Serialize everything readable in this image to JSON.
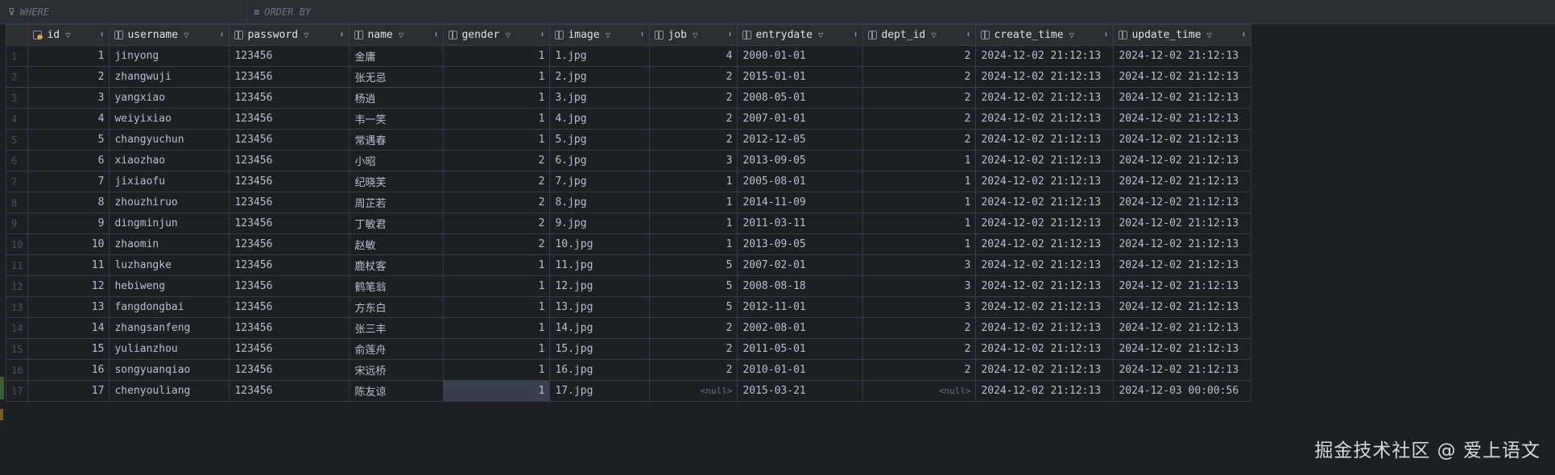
{
  "filterbar": {
    "where_label": "WHERE",
    "orderby_label": "ORDER BY"
  },
  "columns": [
    {
      "key": "id",
      "label": "id",
      "type": "key"
    },
    {
      "key": "username",
      "label": "username",
      "type": "col"
    },
    {
      "key": "password",
      "label": "password",
      "type": "col"
    },
    {
      "key": "name",
      "label": "name",
      "type": "col"
    },
    {
      "key": "gender",
      "label": "gender",
      "type": "col"
    },
    {
      "key": "image",
      "label": "image",
      "type": "col"
    },
    {
      "key": "job",
      "label": "job",
      "type": "col"
    },
    {
      "key": "entrydate",
      "label": "entrydate",
      "type": "col"
    },
    {
      "key": "dept_id",
      "label": "dept_id",
      "type": "col"
    },
    {
      "key": "create_time",
      "label": "create_time",
      "type": "col"
    },
    {
      "key": "update_time",
      "label": "update_time",
      "type": "col"
    }
  ],
  "rows": [
    [
      "1",
      "jinyong",
      "123456",
      "金庸",
      "1",
      "1.jpg",
      "4",
      "2000-01-01",
      "2",
      "2024-12-02 21:12:13",
      "2024-12-02 21:12:13"
    ],
    [
      "2",
      "zhangwuji",
      "123456",
      "张无忌",
      "1",
      "2.jpg",
      "2",
      "2015-01-01",
      "2",
      "2024-12-02 21:12:13",
      "2024-12-02 21:12:13"
    ],
    [
      "3",
      "yangxiao",
      "123456",
      "杨逍",
      "1",
      "3.jpg",
      "2",
      "2008-05-01",
      "2",
      "2024-12-02 21:12:13",
      "2024-12-02 21:12:13"
    ],
    [
      "4",
      "weiyixiao",
      "123456",
      "韦一笑",
      "1",
      "4.jpg",
      "2",
      "2007-01-01",
      "2",
      "2024-12-02 21:12:13",
      "2024-12-02 21:12:13"
    ],
    [
      "5",
      "changyuchun",
      "123456",
      "常遇春",
      "1",
      "5.jpg",
      "2",
      "2012-12-05",
      "2",
      "2024-12-02 21:12:13",
      "2024-12-02 21:12:13"
    ],
    [
      "6",
      "xiaozhao",
      "123456",
      "小昭",
      "2",
      "6.jpg",
      "3",
      "2013-09-05",
      "1",
      "2024-12-02 21:12:13",
      "2024-12-02 21:12:13"
    ],
    [
      "7",
      "jixiaofu",
      "123456",
      "纪晓芙",
      "2",
      "7.jpg",
      "1",
      "2005-08-01",
      "1",
      "2024-12-02 21:12:13",
      "2024-12-02 21:12:13"
    ],
    [
      "8",
      "zhouzhiruo",
      "123456",
      "周芷若",
      "2",
      "8.jpg",
      "1",
      "2014-11-09",
      "1",
      "2024-12-02 21:12:13",
      "2024-12-02 21:12:13"
    ],
    [
      "9",
      "dingminjun",
      "123456",
      "丁敏君",
      "2",
      "9.jpg",
      "1",
      "2011-03-11",
      "1",
      "2024-12-02 21:12:13",
      "2024-12-02 21:12:13"
    ],
    [
      "10",
      "zhaomin",
      "123456",
      "赵敏",
      "2",
      "10.jpg",
      "1",
      "2013-09-05",
      "1",
      "2024-12-02 21:12:13",
      "2024-12-02 21:12:13"
    ],
    [
      "11",
      "luzhangke",
      "123456",
      "鹿杖客",
      "1",
      "11.jpg",
      "5",
      "2007-02-01",
      "3",
      "2024-12-02 21:12:13",
      "2024-12-02 21:12:13"
    ],
    [
      "12",
      "hebiweng",
      "123456",
      "鹤笔翁",
      "1",
      "12.jpg",
      "5",
      "2008-08-18",
      "3",
      "2024-12-02 21:12:13",
      "2024-12-02 21:12:13"
    ],
    [
      "13",
      "fangdongbai",
      "123456",
      "方东白",
      "1",
      "13.jpg",
      "5",
      "2012-11-01",
      "3",
      "2024-12-02 21:12:13",
      "2024-12-02 21:12:13"
    ],
    [
      "14",
      "zhangsanfeng",
      "123456",
      "张三丰",
      "1",
      "14.jpg",
      "2",
      "2002-08-01",
      "2",
      "2024-12-02 21:12:13",
      "2024-12-02 21:12:13"
    ],
    [
      "15",
      "yulianzhou",
      "123456",
      "俞莲舟",
      "1",
      "15.jpg",
      "2",
      "2011-05-01",
      "2",
      "2024-12-02 21:12:13",
      "2024-12-02 21:12:13"
    ],
    [
      "16",
      "songyuanqiao",
      "123456",
      "宋远桥",
      "1",
      "16.jpg",
      "2",
      "2010-01-01",
      "2",
      "2024-12-02 21:12:13",
      "2024-12-02 21:12:13"
    ],
    [
      "17",
      "chenyouliang",
      "123456",
      "陈友谅",
      "1",
      "17.jpg",
      "<null>",
      "2015-03-21",
      "<null>",
      "2024-12-02 21:12:13",
      "2024-12-03 00:00:56"
    ]
  ],
  "row_numbers": [
    "1",
    "2",
    "3",
    "4",
    "5",
    "6",
    "7",
    "8",
    "9",
    "10",
    "11",
    "12",
    "13",
    "14",
    "15",
    "16",
    "17"
  ],
  "selected_cell": {
    "row": 16,
    "col": 4
  },
  "watermark": "掘金技术社区 @ 爱上语文",
  "colors": {
    "background": "#1e1f22",
    "header": "#2b2d30",
    "grid": "#393b40",
    "selection": "#393f4d",
    "key": "#d5a34a"
  }
}
